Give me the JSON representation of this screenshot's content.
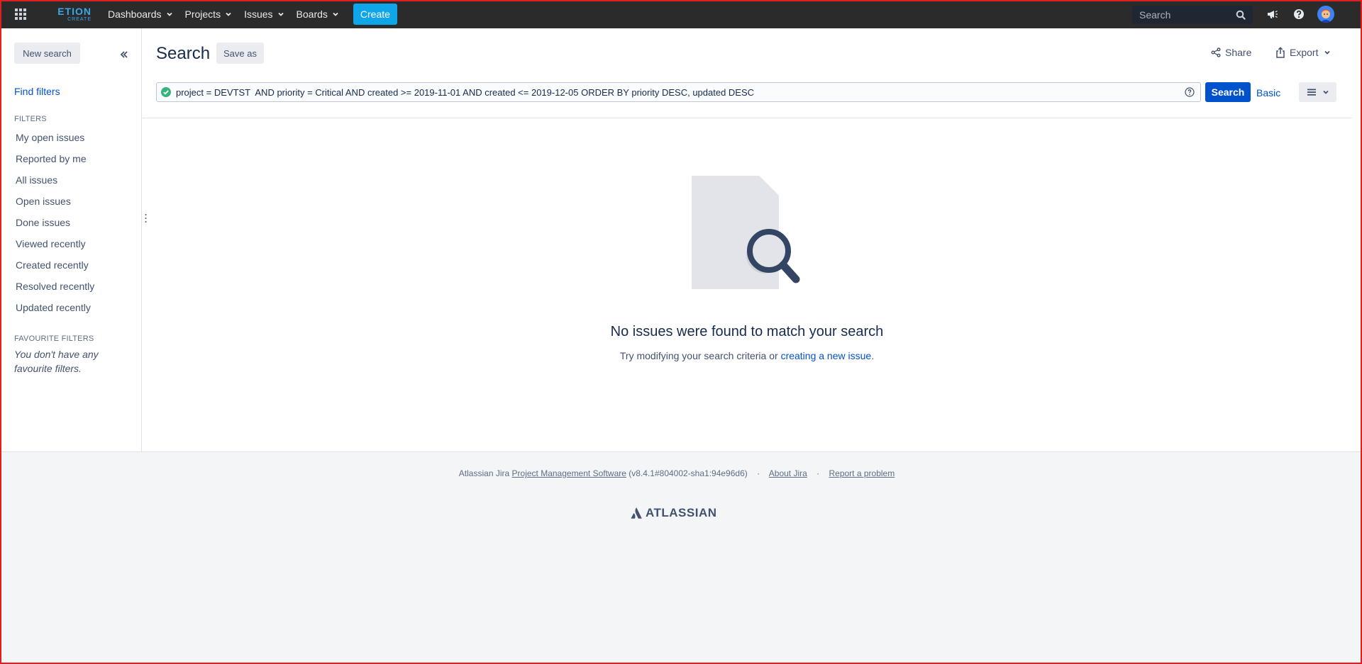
{
  "nav": {
    "logo_main": "ETION",
    "logo_sub": "CREATE",
    "items": [
      {
        "label": "Dashboards"
      },
      {
        "label": "Projects"
      },
      {
        "label": "Issues"
      },
      {
        "label": "Boards"
      }
    ],
    "create_label": "Create",
    "search_placeholder": "Search"
  },
  "sidebar": {
    "new_search": "New search",
    "find_filters": "Find filters",
    "filters_heading": "FILTERS",
    "filters": [
      "My open issues",
      "Reported by me",
      "All issues",
      "Open issues",
      "Done issues",
      "Viewed recently",
      "Created recently",
      "Resolved recently",
      "Updated recently"
    ],
    "favourites_heading": "FAVOURITE FILTERS",
    "favourites_empty": "You don't have any favourite filters."
  },
  "main": {
    "title": "Search",
    "save_as": "Save as",
    "share": "Share",
    "export": "Export",
    "jql": "project = DEVTST  AND priority = Critical AND created >= 2019-11-01 AND created <= 2019-12-05 ORDER BY priority DESC, updated DESC",
    "search_button": "Search",
    "basic_link": "Basic",
    "empty_title": "No issues were found to match your search",
    "empty_text_before": "Try modifying your search criteria or ",
    "empty_link": "creating a new issue",
    "empty_text_after": "."
  },
  "footer": {
    "prefix": "Atlassian Jira",
    "link_pms": "Project Management Software",
    "version": "(v8.4.1#804002-sha1:94e96d6)",
    "about": "About Jira",
    "report": "Report a problem",
    "brand": "ATLASSIAN"
  },
  "colors": {
    "nav_bg": "#2b2b2b",
    "primary": "#0052cc",
    "create": "#0ea5e9",
    "success": "#36b37e",
    "frame": "#e02020"
  }
}
